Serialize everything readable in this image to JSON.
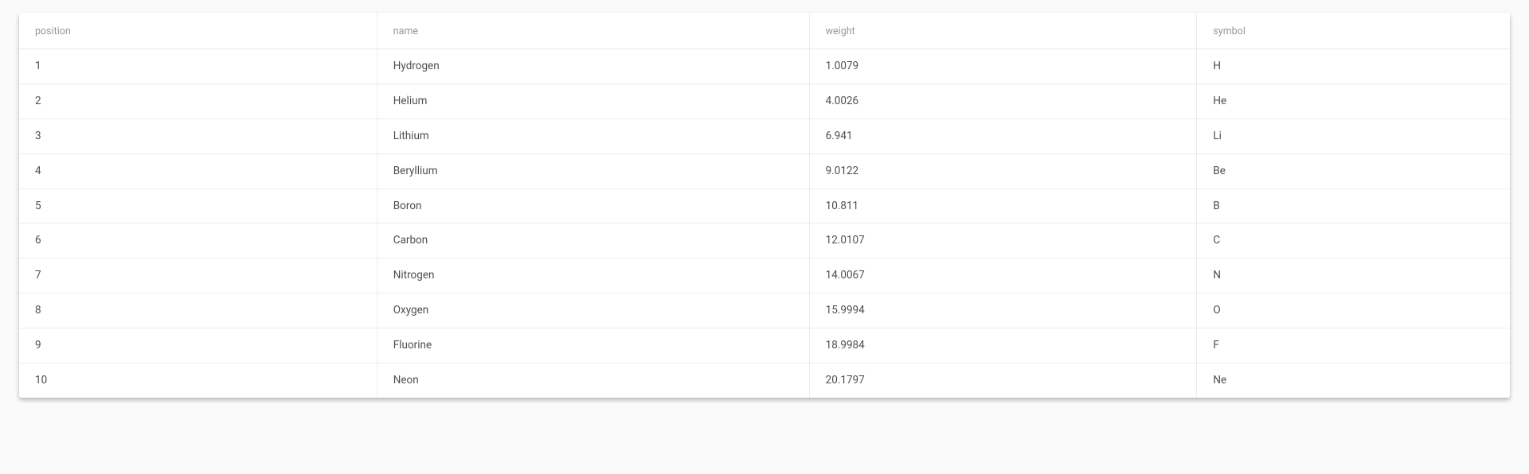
{
  "table": {
    "headers": {
      "position": "position",
      "name": "name",
      "weight": "weight",
      "symbol": "symbol"
    },
    "rows": [
      {
        "position": "1",
        "name": "Hydrogen",
        "weight": "1.0079",
        "symbol": "H"
      },
      {
        "position": "2",
        "name": "Helium",
        "weight": "4.0026",
        "symbol": "He"
      },
      {
        "position": "3",
        "name": "Lithium",
        "weight": "6.941",
        "symbol": "Li"
      },
      {
        "position": "4",
        "name": "Beryllium",
        "weight": "9.0122",
        "symbol": "Be"
      },
      {
        "position": "5",
        "name": "Boron",
        "weight": "10.811",
        "symbol": "B"
      },
      {
        "position": "6",
        "name": "Carbon",
        "weight": "12.0107",
        "symbol": "C"
      },
      {
        "position": "7",
        "name": "Nitrogen",
        "weight": "14.0067",
        "symbol": "N"
      },
      {
        "position": "8",
        "name": "Oxygen",
        "weight": "15.9994",
        "symbol": "O"
      },
      {
        "position": "9",
        "name": "Fluorine",
        "weight": "18.9984",
        "symbol": "F"
      },
      {
        "position": "10",
        "name": "Neon",
        "weight": "20.1797",
        "symbol": "Ne"
      }
    ]
  }
}
